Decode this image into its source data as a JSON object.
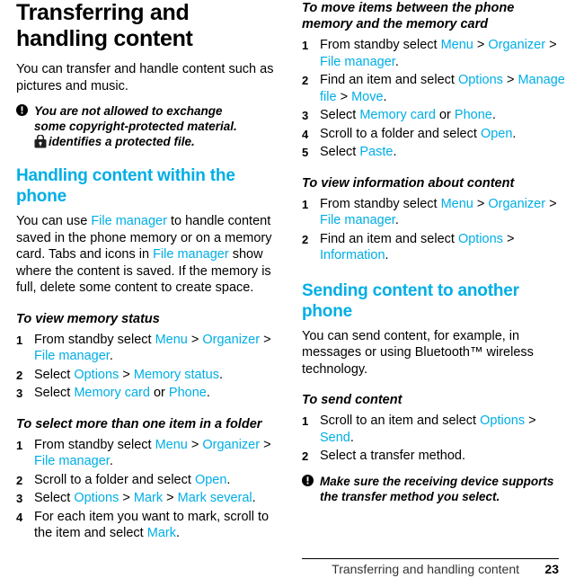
{
  "document": {
    "title": "Transferring and handling content",
    "footer": {
      "text": "Transferring and handling content",
      "page_number": "23"
    }
  },
  "left_column": {
    "intro": "You can transfer and handle content such as pictures and music.",
    "note": {
      "line1": "You are not allowed to exchange",
      "line2": "some copyright-protected material.",
      "line3": "identifies a protected file.",
      "icon": "warning-exclamation-icon",
      "lock_icon": "padlock-icon"
    },
    "section_heading": "Handling content within the phone",
    "section_body": {
      "p1_a": "You can use ",
      "p1_link1": "File manager",
      "p1_b": " to handle content saved in the phone memory or on a memory card. Tabs and icons in ",
      "p1_link2": "File manager",
      "p1_c": " show where the content is saved. If the memory is full, delete some content to create space."
    },
    "proc1": {
      "heading": "To view memory status",
      "steps": [
        {
          "num": "1",
          "parts": [
            {
              "t": "From standby select ",
              "c": "plain"
            },
            {
              "t": "Menu",
              "c": "blue"
            },
            {
              "t": " > ",
              "c": "plain"
            },
            {
              "t": "Organizer",
              "c": "blue"
            },
            {
              "t": " > ",
              "c": "plain"
            },
            {
              "t": "File manager",
              "c": "blue"
            },
            {
              "t": ".",
              "c": "plain"
            }
          ]
        },
        {
          "num": "2",
          "parts": [
            {
              "t": "Select ",
              "c": "plain"
            },
            {
              "t": "Options",
              "c": "blue"
            },
            {
              "t": " > ",
              "c": "plain"
            },
            {
              "t": "Memory status",
              "c": "blue"
            },
            {
              "t": ".",
              "c": "plain"
            }
          ]
        },
        {
          "num": "3",
          "parts": [
            {
              "t": "Select ",
              "c": "plain"
            },
            {
              "t": "Memory card",
              "c": "blue"
            },
            {
              "t": " or ",
              "c": "plain"
            },
            {
              "t": "Phone",
              "c": "blue"
            },
            {
              "t": ".",
              "c": "plain"
            }
          ]
        }
      ]
    },
    "proc2": {
      "heading": "To select more than one item in a folder",
      "steps": [
        {
          "num": "1",
          "parts": [
            {
              "t": "From standby select ",
              "c": "plain"
            },
            {
              "t": "Menu",
              "c": "blue"
            },
            {
              "t": " > ",
              "c": "plain"
            },
            {
              "t": "Organizer",
              "c": "blue"
            },
            {
              "t": " > ",
              "c": "plain"
            },
            {
              "t": "File manager",
              "c": "blue"
            },
            {
              "t": ".",
              "c": "plain"
            }
          ]
        },
        {
          "num": "2",
          "parts": [
            {
              "t": "Scroll to a folder and select ",
              "c": "plain"
            },
            {
              "t": "Open",
              "c": "blue"
            },
            {
              "t": ".",
              "c": "plain"
            }
          ]
        },
        {
          "num": "3",
          "parts": [
            {
              "t": "Select ",
              "c": "plain"
            },
            {
              "t": "Options",
              "c": "blue"
            },
            {
              "t": " > ",
              "c": "plain"
            },
            {
              "t": "Mark",
              "c": "blue"
            },
            {
              "t": " > ",
              "c": "plain"
            },
            {
              "t": "Mark several",
              "c": "blue"
            },
            {
              "t": ".",
              "c": "plain"
            }
          ]
        },
        {
          "num": "4",
          "parts": [
            {
              "t": "For each item you want to mark, scroll to the item and select ",
              "c": "plain"
            },
            {
              "t": "Mark",
              "c": "blue"
            },
            {
              "t": ".",
              "c": "plain"
            }
          ]
        }
      ]
    }
  },
  "right_column": {
    "proc1": {
      "heading": "To move items between the phone memory and the memory card",
      "steps": [
        {
          "num": "1",
          "parts": [
            {
              "t": "From standby select ",
              "c": "plain"
            },
            {
              "t": "Menu",
              "c": "blue"
            },
            {
              "t": " > ",
              "c": "plain"
            },
            {
              "t": "Organizer",
              "c": "blue"
            },
            {
              "t": " > ",
              "c": "plain"
            },
            {
              "t": "File manager",
              "c": "blue"
            },
            {
              "t": ".",
              "c": "plain"
            }
          ]
        },
        {
          "num": "2",
          "parts": [
            {
              "t": "Find an item and select ",
              "c": "plain"
            },
            {
              "t": "Options",
              "c": "blue"
            },
            {
              "t": " > ",
              "c": "plain"
            },
            {
              "t": "Manage file",
              "c": "blue"
            },
            {
              "t": " > ",
              "c": "plain"
            },
            {
              "t": "Move",
              "c": "blue"
            },
            {
              "t": ".",
              "c": "plain"
            }
          ]
        },
        {
          "num": "3",
          "parts": [
            {
              "t": "Select ",
              "c": "plain"
            },
            {
              "t": "Memory card",
              "c": "blue"
            },
            {
              "t": " or ",
              "c": "plain"
            },
            {
              "t": "Phone",
              "c": "blue"
            },
            {
              "t": ".",
              "c": "plain"
            }
          ]
        },
        {
          "num": "4",
          "parts": [
            {
              "t": "Scroll to a folder and select ",
              "c": "plain"
            },
            {
              "t": "Open",
              "c": "blue"
            },
            {
              "t": ".",
              "c": "plain"
            }
          ]
        },
        {
          "num": "5",
          "parts": [
            {
              "t": "Select ",
              "c": "plain"
            },
            {
              "t": "Paste",
              "c": "blue"
            },
            {
              "t": ".",
              "c": "plain"
            }
          ]
        }
      ]
    },
    "proc2": {
      "heading": "To view information about content",
      "steps": [
        {
          "num": "1",
          "parts": [
            {
              "t": "From standby select ",
              "c": "plain"
            },
            {
              "t": "Menu",
              "c": "blue"
            },
            {
              "t": " > ",
              "c": "plain"
            },
            {
              "t": "Organizer",
              "c": "blue"
            },
            {
              "t": " > ",
              "c": "plain"
            },
            {
              "t": "File manager",
              "c": "blue"
            },
            {
              "t": ".",
              "c": "plain"
            }
          ]
        },
        {
          "num": "2",
          "parts": [
            {
              "t": "Find an item and select ",
              "c": "plain"
            },
            {
              "t": "Options",
              "c": "blue"
            },
            {
              "t": " > ",
              "c": "plain"
            },
            {
              "t": "Information",
              "c": "blue"
            },
            {
              "t": ".",
              "c": "plain"
            }
          ]
        }
      ]
    },
    "section_heading": "Sending content to another phone",
    "section_body": "You can send content, for example, in messages or using Bluetooth™ wireless technology.",
    "proc3": {
      "heading": "To send content",
      "steps": [
        {
          "num": "1",
          "parts": [
            {
              "t": "Scroll to an item and select ",
              "c": "plain"
            },
            {
              "t": "Options",
              "c": "blue"
            },
            {
              "t": " > ",
              "c": "plain"
            },
            {
              "t": "Send",
              "c": "blue"
            },
            {
              "t": ".",
              "c": "plain"
            }
          ]
        },
        {
          "num": "2",
          "parts": [
            {
              "t": "Select a transfer method.",
              "c": "plain"
            }
          ]
        }
      ]
    },
    "note": {
      "line1": "Make sure the receiving device supports",
      "line2": "the transfer method you select.",
      "icon": "warning-exclamation-icon"
    }
  }
}
